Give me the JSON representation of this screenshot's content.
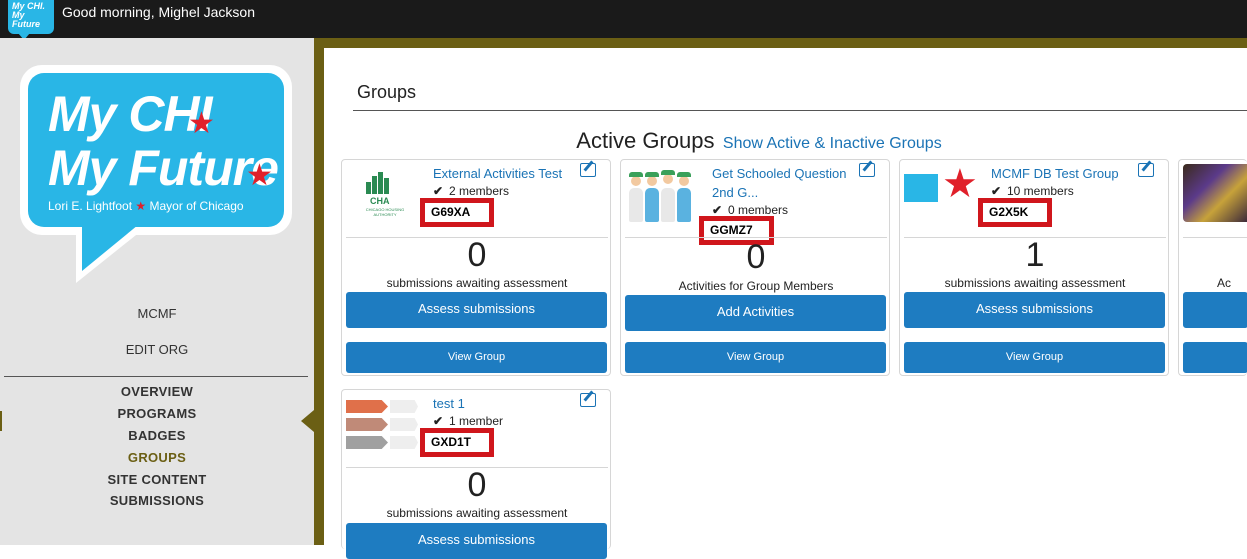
{
  "topbar": {
    "logo_text_line1": "My CHI.",
    "logo_text_line2": "My Future",
    "greeting": "Good morning, Mighel Jackson"
  },
  "sidebar": {
    "logo": {
      "line1": "My CHI",
      "line2": "My Future",
      "subtitle_left": "Lori E. Lightfoot",
      "subtitle_right": "Mayor of Chicago"
    },
    "org_name": "MCMF",
    "edit_org": "EDIT ORG",
    "nav": [
      {
        "label": "OVERVIEW",
        "active": false
      },
      {
        "label": "PROGRAMS",
        "active": false
      },
      {
        "label": "BADGES",
        "active": false
      },
      {
        "label": "GROUPS",
        "active": true
      },
      {
        "label": "SITE CONTENT",
        "active": false
      },
      {
        "label": "SUBMISSIONS",
        "active": false
      }
    ]
  },
  "main": {
    "page_title": "Groups",
    "active_heading": "Active Groups",
    "toggle_link": "Show Active & Inactive Groups",
    "cards": [
      {
        "name": "External Activities Test",
        "members": "2 members",
        "code": "G69XA",
        "count": "0",
        "count_label": "submissions awaiting assessment",
        "primary_action": "Assess submissions",
        "view_label": "View Group",
        "thumb_text": "CHA",
        "thumb_subtext": "CHICAGO HOUSING AUTHORITY"
      },
      {
        "name": "Get Schooled Question 2nd G...",
        "members": "0 members",
        "code": "GGMZ7",
        "count": "0",
        "count_label": "Activities for Group Members",
        "primary_action": "Add Activities",
        "view_label": "View Group"
      },
      {
        "name": "MCMF DB Test Group",
        "members": "10 members",
        "code": "G2X5K",
        "count": "1",
        "count_label": "submissions awaiting assessment",
        "primary_action": "Assess submissions",
        "view_label": "View Group"
      },
      {
        "name": "",
        "members": "",
        "code": "",
        "count": "",
        "count_label": "Ac",
        "primary_action": "",
        "view_label": ""
      },
      {
        "name": "test 1",
        "members": "1 member",
        "code": "GXD1T",
        "count": "0",
        "count_label": "submissions awaiting assessment",
        "primary_action": "Assess submissions"
      }
    ]
  },
  "colors": {
    "brand_blue": "#29b6e6",
    "link_blue": "#1a73b5",
    "button_blue": "#1e7cc1",
    "olive": "#6b5f14",
    "highlight_red": "#d0161c",
    "star_red": "#e0202a"
  }
}
